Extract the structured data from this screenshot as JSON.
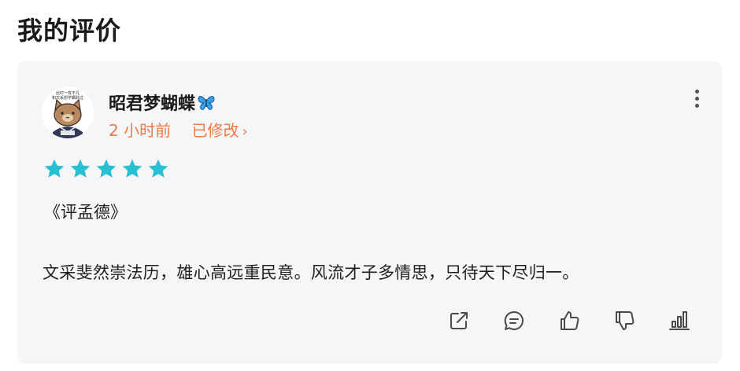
{
  "page": {
    "title": "我的评价"
  },
  "review": {
    "user": {
      "name": "昭君梦蝴蝶",
      "name_emoji_icon": "butterfly-icon",
      "avatar_icon": "cat-avatar",
      "avatar_caption": [
        "此时一枚不凡",
        "和文采想学霸跃过"
      ]
    },
    "time": "2 小时前",
    "edited_label": "已修改",
    "rating": 5,
    "rating_max": 5,
    "rating_color": "#26c0d3",
    "title": "《评孟德》",
    "body": "文采斐然崇法历，雄心高远重民意。风流才子多情思，只待天下尽归一。",
    "accent_color": "#ef7a48",
    "actions": [
      {
        "name": "share",
        "icon": "share-icon"
      },
      {
        "name": "comment",
        "icon": "comment-icon"
      },
      {
        "name": "like",
        "icon": "thumbs-up-icon"
      },
      {
        "name": "dislike",
        "icon": "thumbs-down-icon"
      },
      {
        "name": "stats",
        "icon": "stats-icon"
      }
    ]
  }
}
